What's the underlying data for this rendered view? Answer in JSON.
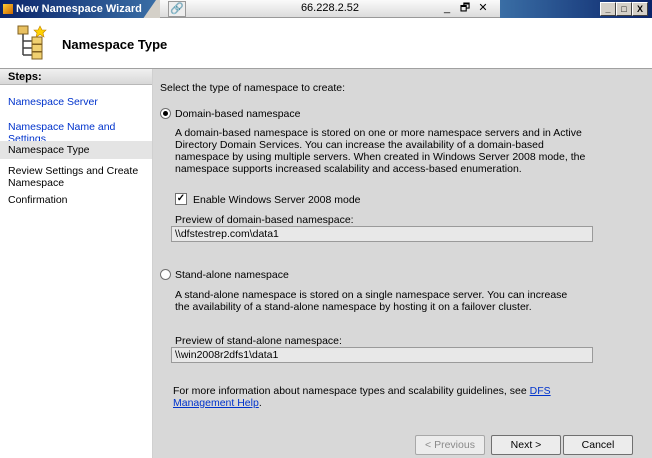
{
  "window": {
    "title": "New Namespace Wizard",
    "rdp_host": "66.228.2.52",
    "rdp_pin": "🔗",
    "rdp_controls": [
      "_",
      "🗗",
      "✕"
    ],
    "caption_buttons": [
      "_",
      "□",
      "X"
    ]
  },
  "header": {
    "title": "Namespace Type"
  },
  "sidebar": {
    "label": "Steps:",
    "items": [
      {
        "label": "Namespace Server",
        "state": "link"
      },
      {
        "label": "Namespace Name and Settings",
        "state": "link"
      },
      {
        "label": "Namespace Type",
        "state": "current"
      },
      {
        "label": "Review Settings and Create Namespace",
        "state": "plain"
      },
      {
        "label": "Confirmation",
        "state": "plain"
      }
    ]
  },
  "main": {
    "instruction": "Select the type of namespace to create:",
    "domain_option": {
      "label": "Domain-based namespace",
      "selected": true,
      "description": "A domain-based namespace is stored on one or more namespace servers and in Active Directory Domain Services. You can increase the availability of a domain-based namespace by using multiple servers. When created in Windows Server 2008 mode, the namespace supports increased scalability and access-based enumeration.",
      "checkbox_label": "Enable Windows Server 2008 mode",
      "checkbox_checked": true,
      "preview_label": "Preview of domain-based namespace:",
      "preview_value": "\\\\dfstestrep.com\\data1"
    },
    "standalone_option": {
      "label": "Stand-alone namespace",
      "selected": false,
      "description": "A stand-alone namespace is stored on a single namespace server. You can increase the availability of a stand-alone namespace by hosting it on a failover cluster.",
      "preview_label": "Preview of stand-alone namespace:",
      "preview_value": "\\\\win2008r2dfs1\\data1"
    },
    "help_text": "For more information about namespace types and scalability guidelines, see ",
    "help_link": "DFS Management Help",
    "help_end": "."
  },
  "buttons": {
    "previous": "< Previous",
    "next": "Next >",
    "cancel": "Cancel"
  },
  "colors": {
    "link": "#0033cc",
    "title_gradient_start": "#0a246a",
    "title_gradient_end": "#3a6ea5",
    "panel_bg": "#d8d8d8"
  }
}
